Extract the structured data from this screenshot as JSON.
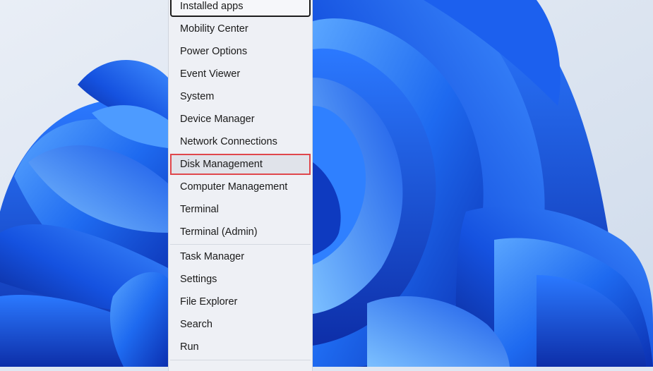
{
  "desktop": {
    "wallpaper": "windows-11-bloom",
    "accent": "#1a5ae8",
    "background": "#dfe7f2"
  },
  "context_menu": {
    "highlight_color": "#e0474c",
    "focused_item": "Installed apps",
    "selected_item": "Disk Management",
    "groups": [
      [
        "Installed apps",
        "Mobility Center",
        "Power Options",
        "Event Viewer",
        "System",
        "Device Manager",
        "Network Connections",
        "Disk Management",
        "Computer Management",
        "Terminal",
        "Terminal (Admin)"
      ],
      [
        "Task Manager",
        "Settings",
        "File Explorer",
        "Search",
        "Run"
      ]
    ]
  }
}
